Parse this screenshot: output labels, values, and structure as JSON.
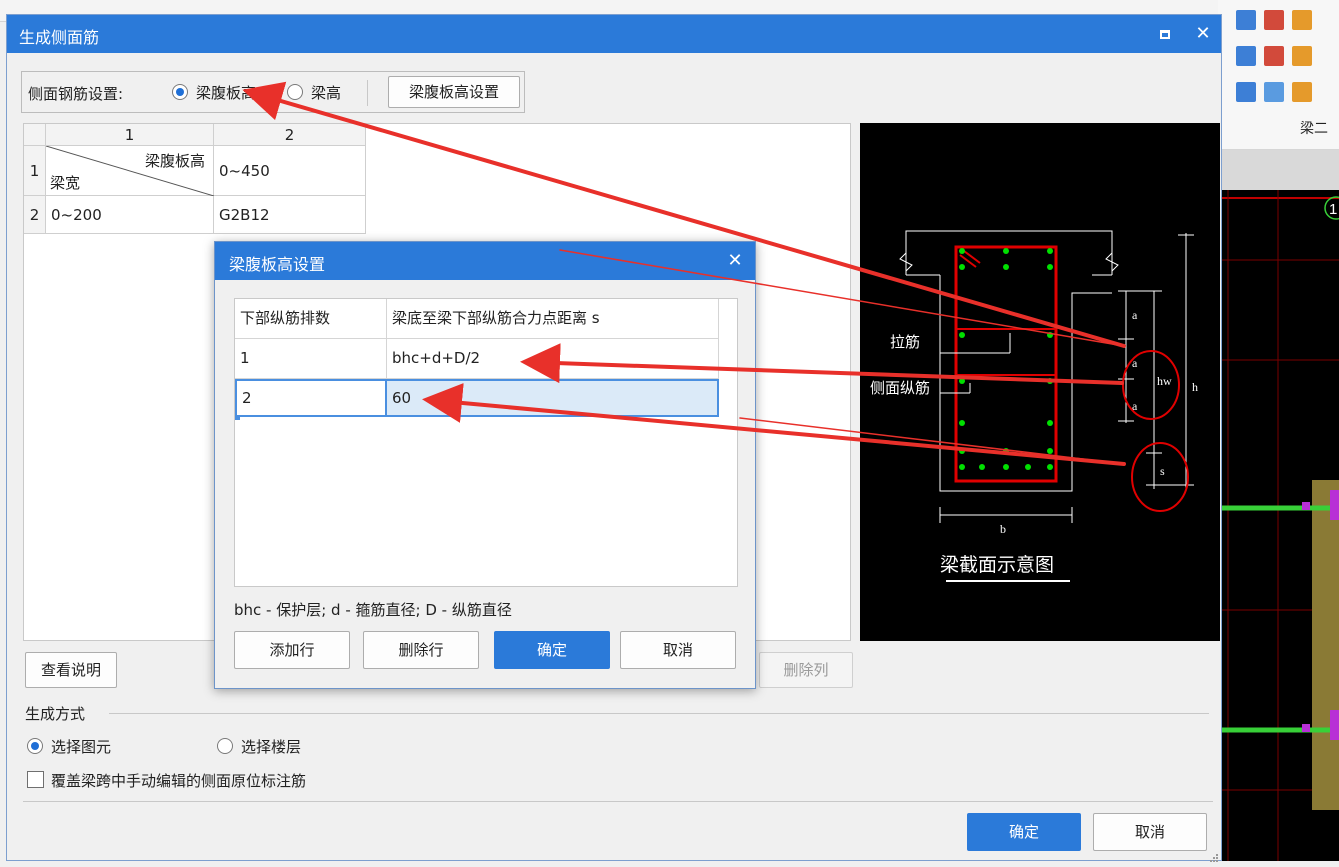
{
  "main_dialog": {
    "title": "生成侧面筋",
    "setting_label": "侧面钢筋设置:",
    "radio_web_height": "梁腹板高",
    "radio_beam_height": "梁高",
    "web_height_settings_button": "梁腹板高设置",
    "grid": {
      "col_headers": [
        "1",
        "2"
      ],
      "row_headers": [
        "1",
        "2"
      ],
      "corner_top": "梁腹板高",
      "corner_bottom": "梁宽",
      "cell_r1c2": "0~450",
      "cell_r2c1": "0~200",
      "cell_r2c2": "G2B12"
    },
    "view_notes_button": "查看说明",
    "delete_column_button": "删除列",
    "generate_mode_label": "生成方式",
    "radio_select_element": "选择图元",
    "radio_select_floor": "选择楼层",
    "overwrite_checkbox_label": "覆盖梁跨中手动编辑的侧面原位标注筋",
    "ok_button": "确定",
    "cancel_button": "取消"
  },
  "diagram": {
    "label_tie_bar": "拉筋",
    "label_side_bar": "侧面纵筋",
    "label_a1": "a",
    "label_a2": "a",
    "label_a3": "a",
    "label_hw": "hw",
    "label_h": "h",
    "label_s": "s",
    "label_b": "b",
    "caption": "梁截面示意图"
  },
  "sub_dialog": {
    "title": "梁腹板高设置",
    "headers": [
      "下部纵筋排数",
      "梁底至梁下部纵筋合力点距离 s"
    ],
    "rows": [
      {
        "count": "1",
        "distance": "bhc+d+D/2"
      },
      {
        "count": "2",
        "distance": "60"
      }
    ],
    "note": "bhc - 保护层; d - 箍筋直径; D - 纵筋直径",
    "add_row_button": "添加行",
    "delete_row_button": "删除行",
    "ok_button": "确定",
    "cancel_button": "取消"
  },
  "background_app": {
    "ribbon_caption": "梁二",
    "cad_marker": "1"
  },
  "colors": {
    "title_bar": "#2b7ad9",
    "annotation_red": "#e8302a",
    "diagram_red": "#e00000",
    "diagram_green": "#00e000",
    "selection_blue": "#dbeaf8"
  }
}
